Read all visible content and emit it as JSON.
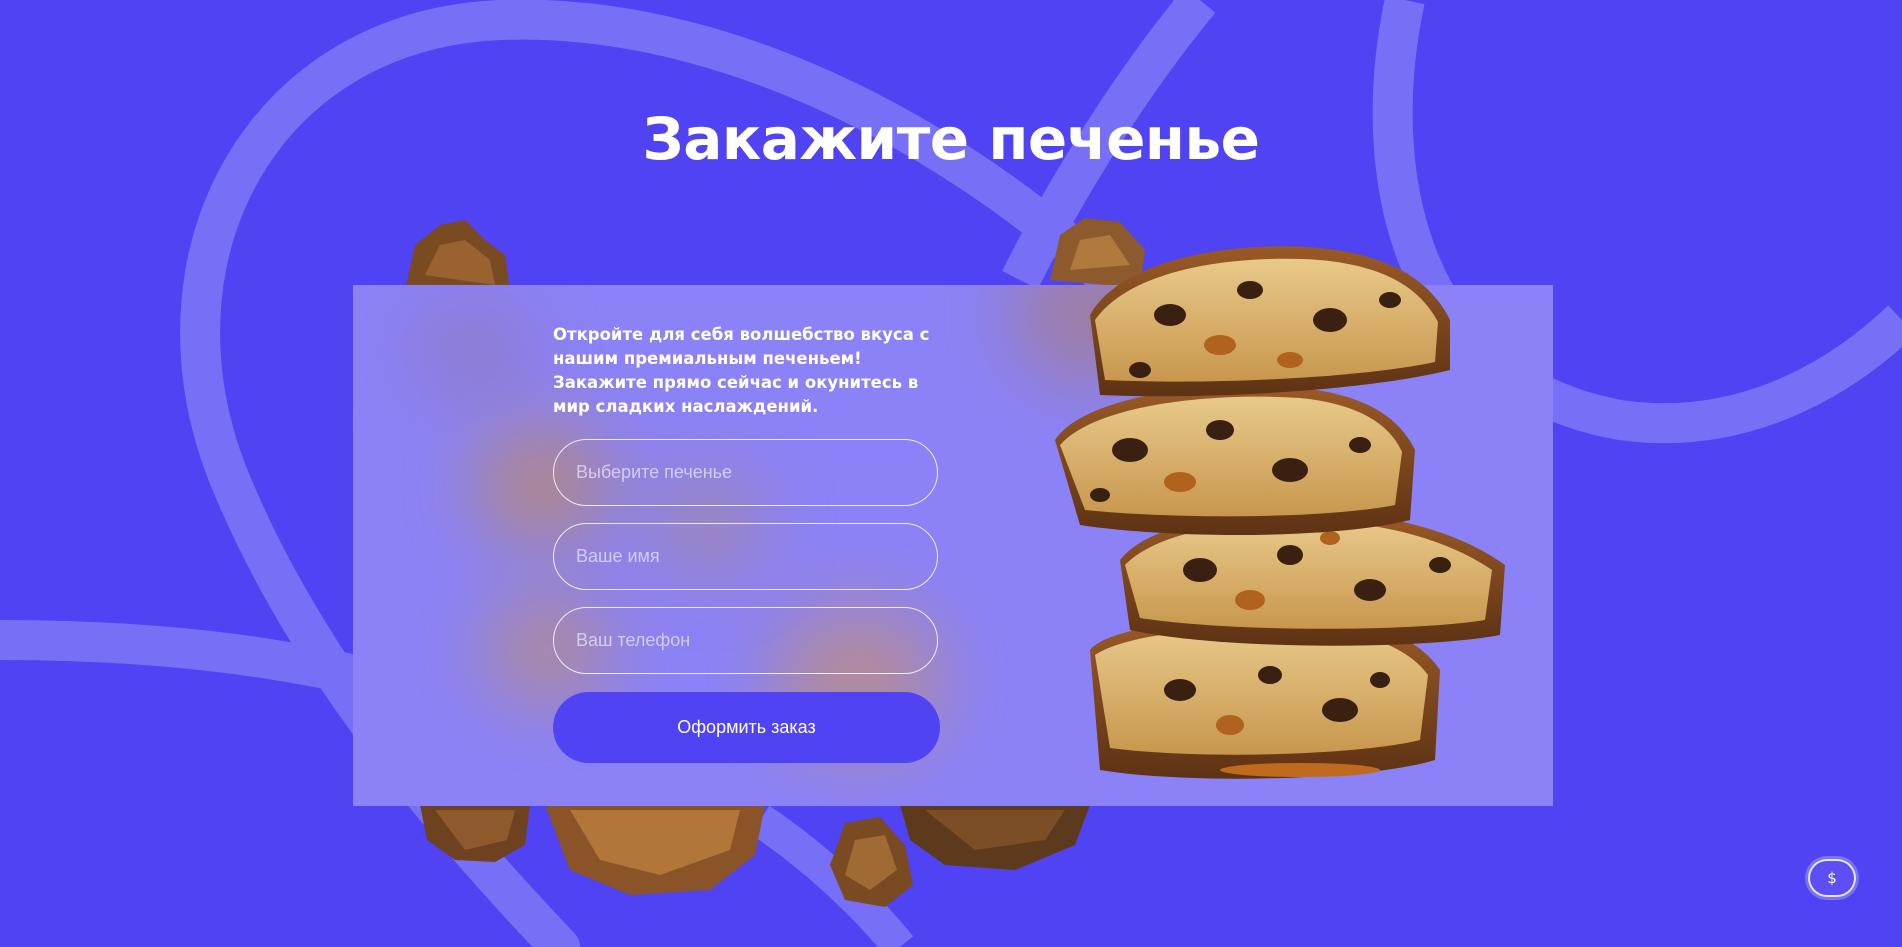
{
  "hero": {
    "title": "Закажите печенье"
  },
  "order_form": {
    "intro": "Откройте для себя волшебство вкуса с нашим премиальным печеньем! Закажите прямо сейчас и окунитесь в мир сладких наслаждений.",
    "cookie_placeholder": "Выберите печенье",
    "name_placeholder": "Ваше имя",
    "phone_placeholder": "Ваш телефон",
    "submit_label": "Оформить заказ"
  },
  "floating_button": {
    "icon": "dollar-icon",
    "symbol": "$"
  },
  "colors": {
    "background": "#4f43f3",
    "card": "#8a82f6",
    "button": "#4f43f3",
    "text": "#ffffff"
  }
}
